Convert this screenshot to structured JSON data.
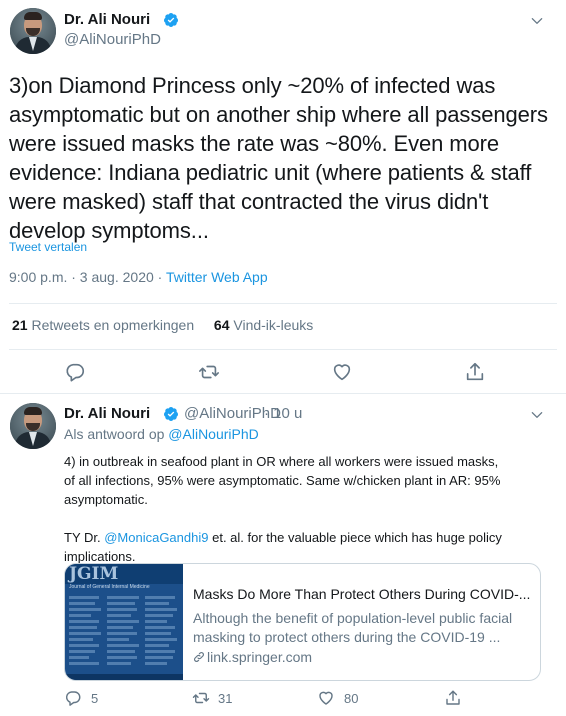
{
  "main_tweet": {
    "author_name": "Dr. Ali Nouri",
    "author_handle": "@AliNouriPhD",
    "text_lines": [
      "3)on Diamond Princess only ~20% of infected was",
      "asymptomatic but on another ship where all passengers",
      "were issued masks the rate was ~80%. Even more",
      "evidence: Indiana pediatric unit (where patients & staff",
      "were masked) staff that contracted the virus didn't",
      "develop symptoms..."
    ],
    "translate_label": "Tweet vertalen",
    "timestamp": "9:00 p.m. · 3 aug. 2020 · ",
    "source_app": "Twitter Web App",
    "retweets_count": "21",
    "retweets_label": "Retweets en opmerkingen",
    "likes_count": "64",
    "likes_label": "Vind-ik-leuks",
    "actions": [
      "reply-icon",
      "retweet-icon",
      "like-icon",
      "share-icon"
    ]
  },
  "reply_tweet": {
    "author_name": "Dr. Ali Nouri",
    "author_handle": "@AliNouriPhD",
    "time_ago": "· 10 u",
    "reply_prefix": "Als antwoord op ",
    "reply_to": "@AliNouriPhD",
    "text_line1": "4) in outbreak in seafood plant in OR where all workers were issued masks,",
    "text_line2": "of all infections, 95% were asymptomatic. Same w/chicken plant in AR: 95%",
    "text_line3": "asymptomatic.",
    "text2_prefix": "TY Dr. ",
    "text2_mention": "@MonicaGandhi9",
    "text2_suffix": " et. al. for the valuable piece which has huge policy",
    "text2_line2": "implications.",
    "card": {
      "thumb_logo": "JGIM",
      "thumb_subtitle": "Journal of General Internal Medicine",
      "title": "Masks Do More Than Protect Others During COVID-...",
      "desc_line1": "Although the benefit of population-level public facial",
      "desc_line2": "masking to protect others during the COVID-19 ...",
      "url": "link.springer.com"
    },
    "reply_count": "5",
    "retweet_count": "31",
    "like_count": "80"
  },
  "colors": {
    "accent": "#1b95e0",
    "muted": "#657786",
    "text": "#14171a",
    "divider": "#e6ecf0"
  }
}
